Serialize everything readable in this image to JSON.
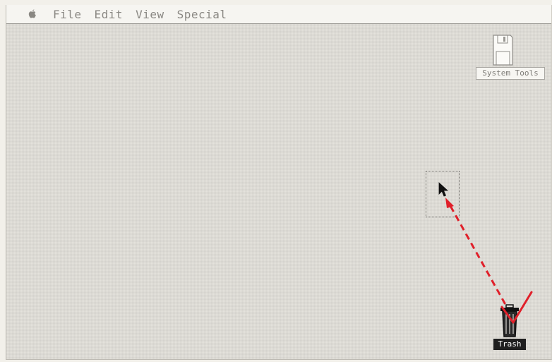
{
  "menubar": {
    "apple_icon": "apple-icon",
    "items": [
      "File",
      "Edit",
      "View",
      "Special"
    ]
  },
  "desktop": {
    "disk": {
      "icon": "floppy-disk-icon",
      "label": "System Tools"
    },
    "trash": {
      "icon": "trash-can-icon",
      "label": "Trash"
    },
    "drag_selection": {
      "icon": "dotted-selection-outline"
    },
    "pointer": {
      "icon": "arrow-cursor-icon"
    }
  },
  "annotation": {
    "arrow_color": "#e0202a",
    "check_color": "#e0202a"
  }
}
